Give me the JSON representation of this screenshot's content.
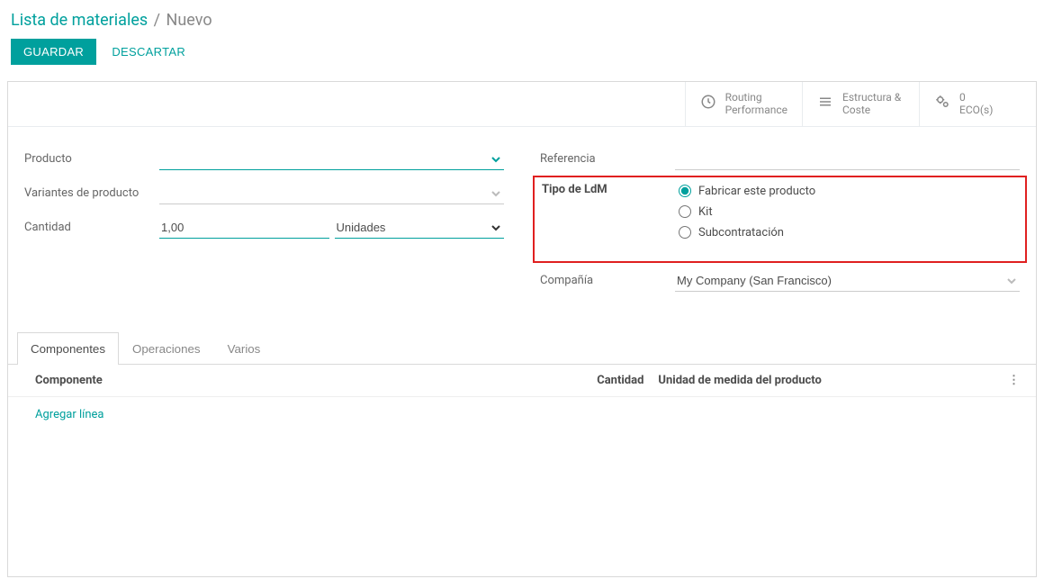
{
  "breadcrumb": {
    "main": "Lista de materiales",
    "sub": "Nuevo"
  },
  "actions": {
    "save": "GUARDAR",
    "discard": "DESCARTAR"
  },
  "statButtons": {
    "routing": {
      "line1": "Routing",
      "line2": "Performance"
    },
    "structure": {
      "line1": "Estructura &",
      "line2": "Coste"
    },
    "ecos": {
      "count": "0",
      "label": "ECO(s)"
    }
  },
  "left": {
    "product_label": "Producto",
    "product_value": "",
    "variants_label": "Variantes de producto",
    "variants_value": "",
    "qty_label": "Cantidad",
    "qty_value": "1,00",
    "qty_uom": "Unidades"
  },
  "right": {
    "ref_label": "Referencia",
    "ref_value": "",
    "type_label": "Tipo de LdM",
    "type_opt1": "Fabricar este producto",
    "type_opt2": "Kit",
    "type_opt3": "Subcontratación",
    "company_label": "Compañía",
    "company_value": "My Company (San Francisco)"
  },
  "tabs": {
    "components": "Componentes",
    "operations": "Operaciones",
    "misc": "Varios"
  },
  "table": {
    "h_component": "Componente",
    "h_qty": "Cantidad",
    "h_uom": "Unidad de medida del producto",
    "add_line": "Agregar línea"
  }
}
